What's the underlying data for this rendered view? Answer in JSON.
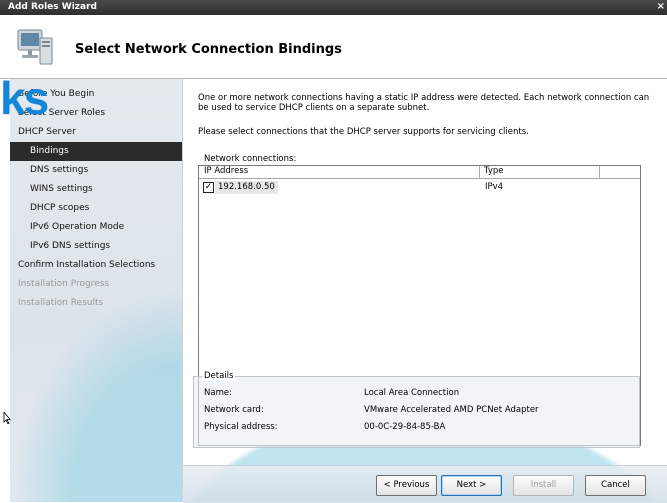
{
  "window": {
    "title": "Add Roles Wizard",
    "close_glyph": "×"
  },
  "header": {
    "title": "Select Network Connection Bindings",
    "icon": "network-computer-icon"
  },
  "watermark": "ks",
  "nav": {
    "items": [
      {
        "label": "Before You Begin",
        "level": "top",
        "state": "normal"
      },
      {
        "label": "Select Server Roles",
        "level": "top",
        "state": "normal"
      },
      {
        "label": "DHCP Server",
        "level": "top",
        "state": "normal"
      },
      {
        "label": "Bindings",
        "level": "sub",
        "state": "selected"
      },
      {
        "label": "DNS settings",
        "level": "sub",
        "state": "normal"
      },
      {
        "label": "WINS settings",
        "level": "sub",
        "state": "normal"
      },
      {
        "label": "DHCP scopes",
        "level": "sub",
        "state": "normal"
      },
      {
        "label": "IPv6 Operation Mode",
        "level": "sub",
        "state": "normal"
      },
      {
        "label": "IPv6 DNS settings",
        "level": "sub",
        "state": "normal"
      },
      {
        "label": "Confirm Installation Selections",
        "level": "top",
        "state": "normal"
      },
      {
        "label": "Installation Progress",
        "level": "top",
        "state": "disabled"
      },
      {
        "label": "Installation Results",
        "level": "top",
        "state": "disabled"
      }
    ]
  },
  "main": {
    "description": "One or more network connections having a static IP address were detected. Each network connection can be used to service DHCP clients on a separate subnet.",
    "instruction": "Please select connections that the DHCP server supports for servicing clients.",
    "list_label": "Network connections:",
    "columns": [
      "IP Address",
      "Type"
    ],
    "rows": [
      {
        "checked": true,
        "ip": "192.168.0.50",
        "type": "IPv4"
      }
    ],
    "details": {
      "legend": "Details",
      "fields": [
        {
          "label": "Name:",
          "value": "Local Area Connection"
        },
        {
          "label": "Network card:",
          "value": "VMware Accelerated AMD PCNet Adapter"
        },
        {
          "label": "Physical address:",
          "value": "00-0C-29-84-85-BA"
        }
      ]
    }
  },
  "footer": {
    "previous": "< Previous",
    "next": "Next >",
    "install": "Install",
    "cancel": "Cancel"
  },
  "colors": {
    "selected_nav_bg": "#2b2b2b",
    "watermark": "#1486d8",
    "accent_curve": "#8cd0e4"
  }
}
